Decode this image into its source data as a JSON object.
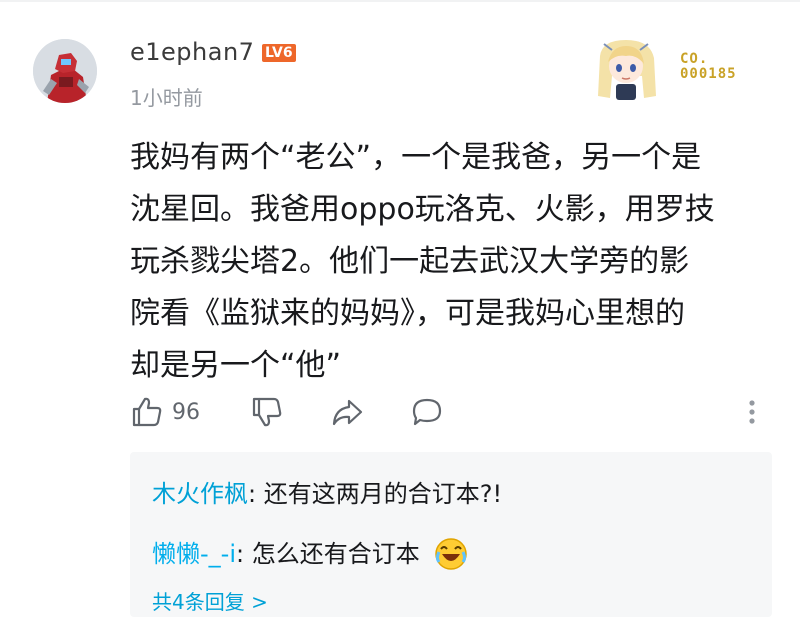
{
  "user": {
    "name": "e1ephan7",
    "level": "LV6",
    "time": "1小时前"
  },
  "decoration": {
    "label": "CO.",
    "number": "000185"
  },
  "comment": {
    "lines": [
      "我妈有两个“老公”，一个是我爸，另一个是",
      "沈星回。我爸用oppo玩洛克、火影，用罗技",
      "玩杀戮尖塔2。他们一起去武汉大学旁的影",
      "院看《监狱来的妈妈》，可是我妈心里想的",
      "却是另一个“他”"
    ]
  },
  "actions": {
    "like_count": "96"
  },
  "replies": {
    "items": [
      {
        "name": "木火作枫",
        "text": ": 还有这两月的合订本?!"
      },
      {
        "name": "懒懒-_-i",
        "text": ": 怎么还有合订本"
      }
    ],
    "more_label": "共4条回复 >"
  },
  "colors": {
    "link": "#00a1d6",
    "level_badge": "#ee672a",
    "muted": "#9499a0",
    "reply_bg": "#f6f7f8"
  },
  "icons": [
    "like-icon",
    "dislike-icon",
    "share-icon",
    "reply-icon",
    "more-vertical-icon",
    "laughing-emoji-icon"
  ]
}
